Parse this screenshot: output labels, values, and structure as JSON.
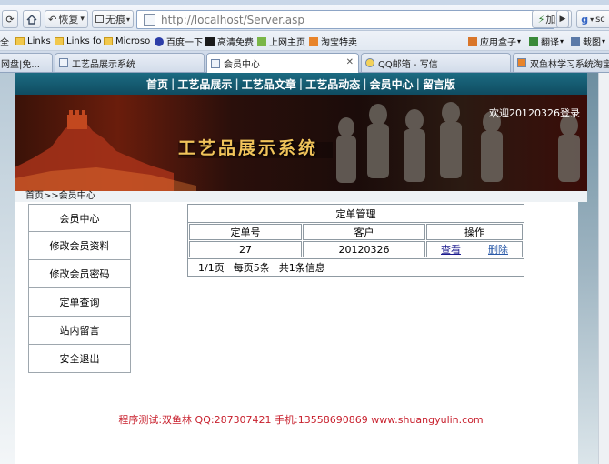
{
  "browser": {
    "nav": {
      "back_label": "",
      "home_label": "",
      "restore_label": "恢复",
      "restore_dropdown": "▾",
      "no_image_label": "无痕",
      "url": "http://localhost/Server.asp",
      "accelerate_label": "加速"
    },
    "bookmarks": [
      {
        "label": "全"
      },
      {
        "label": "Links"
      },
      {
        "label": "Links fo"
      },
      {
        "label": "Microso"
      },
      {
        "label": "百度一下"
      },
      {
        "label": "高清免费"
      },
      {
        "label": "上网主页"
      },
      {
        "label": "淘宝特卖"
      },
      {
        "label": "应用盒子"
      },
      {
        "label": "翻译"
      },
      {
        "label": "截图"
      }
    ],
    "tabs": [
      {
        "label": "网盘|免..."
      },
      {
        "label": "工艺品展示系统"
      },
      {
        "label": "会员中心"
      },
      {
        "label": "QQ邮箱 - 写信"
      },
      {
        "label": "双鱼林学习系统淘宝店"
      }
    ]
  },
  "site": {
    "topnav": [
      "首页",
      "工艺品展示",
      "工艺品文章",
      "工艺品动态",
      "会员中心",
      "留言版"
    ],
    "banner_title": "工艺品展示系统",
    "welcome": "欢迎20120326登录",
    "breadcrumb": "首页>>会员中心"
  },
  "menu": [
    "会员中心",
    "修改会员资料",
    "修改会员密码",
    "定单查询",
    "站内留言",
    "安全退出"
  ],
  "orders": {
    "caption": "定单管理",
    "headers": [
      "定单号",
      "客户",
      "操作"
    ],
    "rows": [
      {
        "order_no": "27",
        "customer": "20120326",
        "view": "查看",
        "delete": "删除"
      }
    ],
    "pager": {
      "page": "1/1页",
      "per_page": "每页5条",
      "total": "共1条信息"
    }
  },
  "footer": "程序测试:双鱼林 QQ:287307421 手机:13558690869 www.shuangyulin.com"
}
